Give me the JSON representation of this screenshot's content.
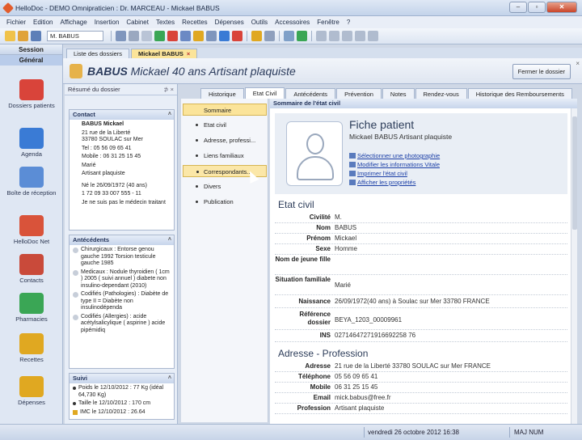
{
  "window": {
    "title": "HelloDoc - DEMO Omnipraticien : Dr. MARCEAU - Mickael BABUS"
  },
  "menu": [
    "Fichier",
    "Edition",
    "Affichage",
    "Insertion",
    "Cabinet",
    "Textes",
    "Recettes",
    "Dépenses",
    "Outils",
    "Accessoires",
    "Fenêtre",
    "?"
  ],
  "toolbar": {
    "patient_combo": "M. BABUS"
  },
  "sidebar": {
    "header": "Session",
    "group": "Général",
    "items": [
      {
        "label": "Dossiers patients",
        "icon": "patient-folder-icon",
        "color": "#d9443a"
      },
      {
        "label": "Agenda",
        "icon": "calendar-icon",
        "color": "#3a7bd5"
      },
      {
        "label": "Boîte de réception",
        "icon": "inbox-icon",
        "color": "#5b8dd6"
      },
      {
        "label": "HelloDoc Net",
        "icon": "network-icon",
        "color": "#d9533a"
      },
      {
        "label": "Contacts",
        "icon": "contacts-icon",
        "color": "#c94a3a"
      },
      {
        "label": "Pharmacies",
        "icon": "pharmacy-icon",
        "color": "#3aa655"
      },
      {
        "label": "Recettes",
        "icon": "income-icon",
        "color": "#e0a821"
      },
      {
        "label": "Dépenses",
        "icon": "expense-icon",
        "color": "#e0a821"
      }
    ]
  },
  "doc_tabs": [
    {
      "label": "Liste des dossiers"
    },
    {
      "label": "Mickael BABUS",
      "close": "×"
    }
  ],
  "patient_header": {
    "last_name": "BABUS",
    "rest": "Mickael 40 ans Artisant plaquiste",
    "close_button": "Fermer le dossier",
    "close_x": "×"
  },
  "resume": {
    "title": "Résumé du dossier",
    "controls": "⊅ ×",
    "contact": {
      "title": "Contact",
      "name": "BABUS Mickael",
      "address1": "21 rue de la Liberté",
      "address2": "33780 SOULAC sur Mer",
      "tel": "Tel : 05 56 09 65 41",
      "mobile": "Mobile : 06 31 25 15 45",
      "status": "Marié",
      "job": "Artisant plaquiste",
      "born": "Né le 26/09/1972 (40 ans)",
      "ins": "1 72 09 33 007 555 - 11",
      "doctor": "Je ne suis pas le médecin traitant"
    },
    "antecedents": {
      "title": "Antécédents",
      "items": [
        "Chirurgicaux : Entorse genou gauche 1992 Torsion testicule gauche 1985",
        "Medicaux : Nodule thyroidien ( 1cm ) 2005 ( suivi annuel ) diabete non insulino-dependant (2010)",
        "Codifiés (Pathologies) : Diabète de type II = Diabète non insulinodépenda",
        "Codifiés (Allergies) : acide acétylsalicylique ( aspirine ) acide pipémidiq"
      ]
    },
    "suivi": {
      "title": "Suivi",
      "items": [
        "Poids le 12/10/2012 : 77 Kg (idéal 64,730 Kg)",
        "Taille le 12/10/2012 : 170 cm",
        "IMC le 12/10/2012 : 26.64"
      ]
    }
  },
  "sub_tabs": [
    "Historique",
    "Etat Civil",
    "Antécédents",
    "Prévention",
    "Notes",
    "Rendez-vous",
    "Historique des Remboursements"
  ],
  "sommaire": {
    "title": "Sommaire",
    "items": [
      "Etat civil",
      "Adresse, professi...",
      "Liens familiaux",
      "Correspondants...",
      "Divers",
      "Publication"
    ]
  },
  "content": {
    "title": "Sommaire de l'état civil",
    "fiche": {
      "title": "Fiche patient",
      "subtitle": "Mickael BABUS Artisant plaquiste",
      "links": [
        "Sélectionner une photographie",
        "Modifier les informations Vitale",
        "Imprimer l'état civil",
        "Afficher les propriétés"
      ]
    },
    "etat_civil": {
      "heading": "Etat civil",
      "rows": [
        {
          "k": "Civilité",
          "v": "M."
        },
        {
          "k": "Nom",
          "v": "BABUS"
        },
        {
          "k": "Prénom",
          "v": "Mickael"
        },
        {
          "k": "Sexe",
          "v": "Homme"
        },
        {
          "k": "Nom de jeune fille",
          "v": ""
        },
        {
          "k": "Situation familiale",
          "v": "Marié"
        },
        {
          "k": "Naissance",
          "v": "26/09/1972(40 ans) à Soulac sur Mer 33780 FRANCE"
        },
        {
          "k": "Référence dossier",
          "v": "BEYA_1203_00009961"
        },
        {
          "k": "INS",
          "v": "02714647271916692258 76"
        }
      ]
    },
    "adresse": {
      "heading": "Adresse - Profession",
      "rows": [
        {
          "k": "Adresse",
          "v": "21 rue de la Liberté 33780 SOULAC sur Mer FRANCE"
        },
        {
          "k": "Téléphone",
          "v": "05 56 09 65 41"
        },
        {
          "k": "Mobile",
          "v": "06 31 25 15 45"
        },
        {
          "k": "Email",
          "v": "mick.babus@free.fr"
        },
        {
          "k": "Profession",
          "v": "Artisant plaquiste"
        }
      ]
    }
  },
  "status": {
    "date": "vendredi 26 octobre 2012 16:38",
    "keys": "MAJ NUM"
  }
}
